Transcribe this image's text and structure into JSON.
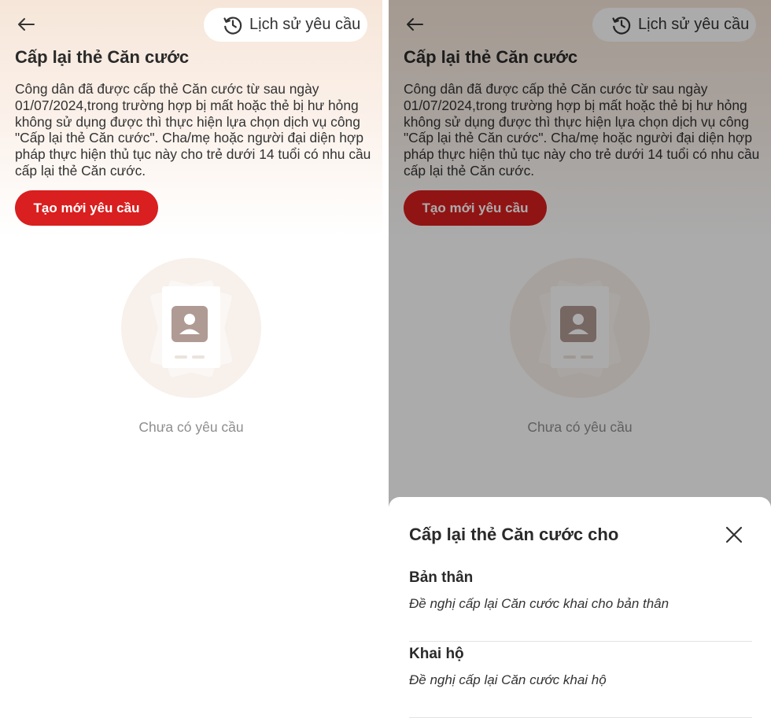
{
  "screens": [
    {
      "title": "Cấp lại thẻ Căn cước",
      "history_label": "Lịch sử yêu cầu",
      "description": "Công dân đã được cấp thẻ Căn cước từ sau ngày 01/07/2024,trong trường hợp bị mất hoặc thẻ bị hư hỏng không sử dụng được thì thực hiện lựa chọn dịch vụ công \"Cấp lại thẻ Căn cước\". Cha/mẹ hoặc người đại diện hợp pháp thực hiện thủ tục này cho trẻ dưới 14 tuổi có nhu cầu cấp lại thẻ Căn cước.",
      "create_label": "Tạo mới yêu cầu",
      "empty_text": "Chưa có yêu cầu"
    },
    {
      "title": "Cấp lại thẻ Căn cước",
      "history_label": "Lịch sử yêu cầu",
      "description": "Công dân đã được cấp thẻ Căn cước từ sau ngày 01/07/2024,trong trường hợp bị mất hoặc thẻ bị hư hỏng không sử dụng được thì thực hiện lựa chọn dịch vụ công \"Cấp lại thẻ Căn cước\". Cha/mẹ hoặc người đại diện hợp pháp thực hiện thủ tục này cho trẻ dưới 14 tuổi có nhu cầu cấp lại thẻ Căn cước.",
      "create_label": "Tạo mới yêu cầu",
      "empty_text": "Chưa có yêu cầu"
    }
  ],
  "sheet": {
    "title": "Cấp lại thẻ Căn cước cho",
    "options": [
      {
        "title": "Bản thân",
        "description": "Đề nghị cấp lại Căn cước khai cho bản thân"
      },
      {
        "title": "Khai hộ",
        "description": "Đề nghị cấp lại Căn cước khai hộ"
      }
    ]
  },
  "colors": {
    "brand_red": "#d91f1f",
    "header_gradient_top": "#f6e6d9",
    "overlay": "rgba(0,0,0,0.33)"
  },
  "icons": {
    "back": "arrow-left-icon",
    "history": "clock-history-icon",
    "close": "close-icon",
    "empty_state": "id-card-illustration"
  }
}
